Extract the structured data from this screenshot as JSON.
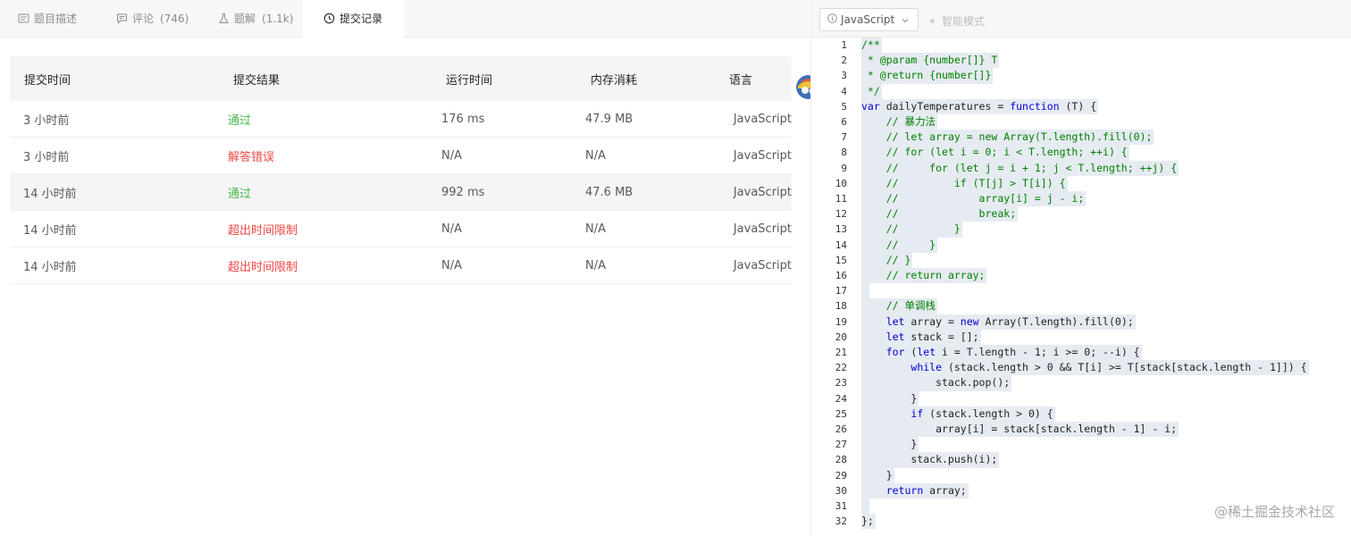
{
  "tabs": [
    {
      "label": "题目描述",
      "count": "",
      "icon": "description-icon"
    },
    {
      "label": "评论",
      "count": "(746)",
      "icon": "comment-icon"
    },
    {
      "label": "题解",
      "count": "(1.1k)",
      "icon": "flask-icon"
    },
    {
      "label": "提交记录",
      "count": "",
      "icon": "clock-icon",
      "active": true
    }
  ],
  "table": {
    "headers": [
      "提交时间",
      "提交结果",
      "运行时间",
      "内存消耗",
      "语言"
    ],
    "rows": [
      {
        "time": "3 小时前",
        "result": "通过",
        "status": "ok",
        "runtime": "176 ms",
        "memory": "47.9 MB",
        "lang": "JavaScript"
      },
      {
        "time": "3 小时前",
        "result": "解答错误",
        "status": "err",
        "runtime": "N/A",
        "memory": "N/A",
        "lang": "JavaScript"
      },
      {
        "time": "14 小时前",
        "result": "通过",
        "status": "ok",
        "runtime": "992 ms",
        "memory": "47.6 MB",
        "lang": "JavaScript"
      },
      {
        "time": "14 小时前",
        "result": "超出时间限制",
        "status": "err",
        "runtime": "N/A",
        "memory": "N/A",
        "lang": "JavaScript"
      },
      {
        "time": "14 小时前",
        "result": "超出时间限制",
        "status": "err",
        "runtime": "N/A",
        "memory": "N/A",
        "lang": "JavaScript"
      }
    ]
  },
  "editor": {
    "language": "JavaScript",
    "mode_label": "智能模式",
    "lines": [
      "/**",
      " * @param {number[]} T",
      " * @return {number[]}",
      " */",
      "var dailyTemperatures = function (T) {",
      "    // 暴力法",
      "    // let array = new Array(T.length).fill(0);",
      "    // for (let i = 0; i < T.length; ++i) {",
      "    //     for (let j = i + 1; j < T.length; ++j) {",
      "    //         if (T[j] > T[i]) {",
      "    //             array[i] = j - i;",
      "    //             break;",
      "    //         }",
      "    //     }",
      "    // }",
      "    // return array;",
      "",
      "    // 单调栈",
      "    let array = new Array(T.length).fill(0);",
      "    let stack = [];",
      "    for (let i = T.length - 1; i >= 0; --i) {",
      "        while (stack.length > 0 && T[i] >= T[stack[stack.length - 1]]) {",
      "            stack.pop();",
      "        }",
      "        if (stack.length > 0) {",
      "            array[i] = stack[stack.length - 1] - i;",
      "        }",
      "        stack.push(i);",
      "    }",
      "    return array;",
      "",
      "};"
    ]
  },
  "watermark": "@稀土掘金技术社区"
}
